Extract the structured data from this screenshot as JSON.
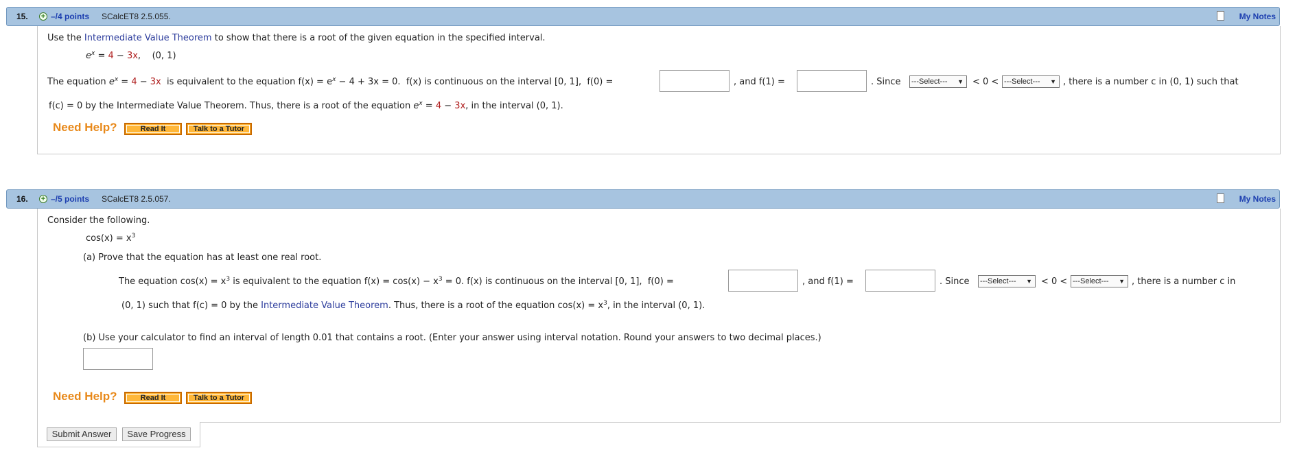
{
  "q15": {
    "number": "15.",
    "points": "–/4 points",
    "code": "SCalcET8 2.5.055.",
    "my_notes": "My Notes",
    "intro_pre": "Use the ",
    "intro_link": "Intermediate Value Theorem",
    "intro_post": " to show that there is a root of the given equation in the specified interval.",
    "eq_e": "e",
    "eq_x": "x",
    "eq_eq": " = ",
    "eq_four": "4",
    "eq_minus": " − ",
    "eq_3x": "3x",
    "eq_comma": ",",
    "eq_interval": "(0, 1)",
    "line1_a": "The equation ",
    "line1_b": " is equivalent to the equation ",
    "line1_fx": "f(x) = e",
    "line1_rest": " − 4 + 3x = 0.",
    "line1_cont": "f(x)  is continuous on the interval  [0, 1],",
    "f0_label": "f(0) =",
    "and_label": ",  and  f(1) =",
    "since_label": ".  Since",
    "select_placeholder": "---Select---",
    "lt0lt": "< 0 <",
    "tail": ",  there is a number c in  (0, 1)  such that",
    "line2_a": "f(c) = 0  by the Intermediate Value Theorem. Thus, there is a root of the equation  ",
    "line2_b": ",  in the interval  (0, 1)."
  },
  "q16": {
    "number": "16.",
    "points": "–/5 points",
    "code": "SCalcET8 2.5.057.",
    "my_notes": "My Notes",
    "intro": "Consider the following.",
    "eq_cos": "cos(x) = x",
    "eq_pow": "3",
    "part_a": "(a) Prove that the equation has at least one real root.",
    "line1_a": "The equation  cos(x) = x",
    "line1_b": "  is equivalent to the equation  f(x) = cos(x) − x",
    "line1_c": " = 0.  f(x)  is continuous on the interval  [0, 1],",
    "f0_label": "f(0) =",
    "and_label": ",  and  f(1) =",
    "since_label": ".  Since",
    "select_placeholder": "---Select---",
    "lt0lt": "< 0 <",
    "tail": ",  there is a number c in",
    "line2_a": "(0, 1)  such that  f(c) = 0  by the ",
    "line2_link": "Intermediate Value Theorem",
    "line2_b": ". Thus, there is a root of the equation  cos(x) = x",
    "line2_c": ",  in the interval  (0, 1).",
    "part_b": "(b) Use your calculator to find an interval of length 0.01 that contains a root. (Enter your answer using interval notation. Round your answers to two decimal places.)"
  },
  "help": {
    "need_help": "Need Help?",
    "read_it": "Read It",
    "talk_tutor": "Talk to a Tutor"
  },
  "buttons": {
    "submit": "Submit Answer",
    "save": "Save Progress"
  }
}
